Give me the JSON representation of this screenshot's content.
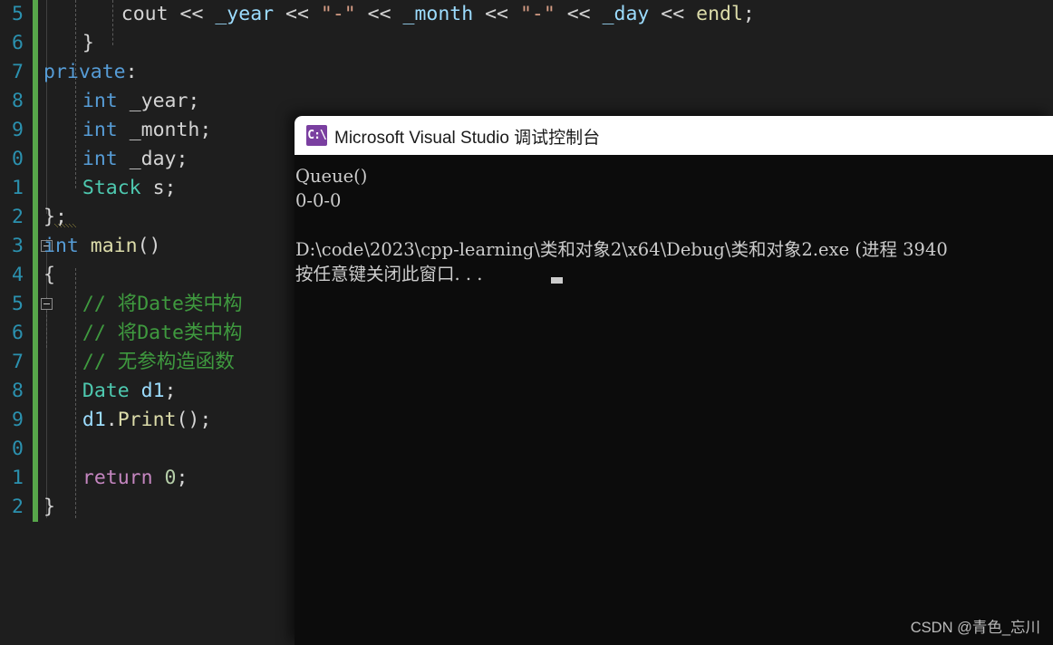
{
  "editor": {
    "name": "visual-studio-code-editor",
    "background": "#1e1e1e",
    "gutter_color": "#2b91af",
    "change_bar_color": "#57a64a",
    "lines": [
      {
        "number": "5",
        "indent": 6,
        "tokens": [
          {
            "t": "cout",
            "c": "plain"
          },
          {
            "t": " << ",
            "c": "plain"
          },
          {
            "t": "_year",
            "c": "var"
          },
          {
            "t": " << ",
            "c": "plain"
          },
          {
            "t": "\"-\"",
            "c": "str"
          },
          {
            "t": " << ",
            "c": "plain"
          },
          {
            "t": "_month",
            "c": "var"
          },
          {
            "t": " << ",
            "c": "plain"
          },
          {
            "t": "\"-\"",
            "c": "str"
          },
          {
            "t": " << ",
            "c": "plain"
          },
          {
            "t": "_day",
            "c": "var"
          },
          {
            "t": " << ",
            "c": "plain"
          },
          {
            "t": "endl",
            "c": "fn"
          },
          {
            "t": ";",
            "c": "punct"
          }
        ]
      },
      {
        "number": "6",
        "indent": 3,
        "tokens": [
          {
            "t": "}",
            "c": "punct"
          }
        ]
      },
      {
        "number": "7",
        "indent": 0,
        "tokens": [
          {
            "t": "private",
            "c": "kw"
          },
          {
            "t": ":",
            "c": "punct"
          }
        ]
      },
      {
        "number": "8",
        "indent": 3,
        "tokens": [
          {
            "t": "int",
            "c": "kw"
          },
          {
            "t": " ",
            "c": "plain"
          },
          {
            "t": "_year",
            "c": "plain"
          },
          {
            "t": ";",
            "c": "punct"
          }
        ]
      },
      {
        "number": "9",
        "indent": 3,
        "tokens": [
          {
            "t": "int",
            "c": "kw"
          },
          {
            "t": " ",
            "c": "plain"
          },
          {
            "t": "_month",
            "c": "plain"
          },
          {
            "t": ";",
            "c": "punct"
          }
        ]
      },
      {
        "number": "0",
        "indent": 3,
        "tokens": [
          {
            "t": "int",
            "c": "kw"
          },
          {
            "t": " ",
            "c": "plain"
          },
          {
            "t": "_day",
            "c": "plain"
          },
          {
            "t": ";",
            "c": "punct"
          }
        ]
      },
      {
        "number": "1",
        "indent": 3,
        "tokens": [
          {
            "t": "Stack",
            "c": "type"
          },
          {
            "t": " ",
            "c": "plain"
          },
          {
            "t": "s",
            "c": "plain"
          },
          {
            "t": ";",
            "c": "punct"
          }
        ]
      },
      {
        "number": "2",
        "indent": 0,
        "tokens": [
          {
            "t": "};",
            "c": "punct"
          }
        ]
      },
      {
        "number": "3",
        "indent": 0,
        "tokens": [
          {
            "t": "int",
            "c": "kw"
          },
          {
            "t": " ",
            "c": "plain"
          },
          {
            "t": "main",
            "c": "fn"
          },
          {
            "t": "()",
            "c": "punct"
          }
        ]
      },
      {
        "number": "4",
        "indent": 0,
        "tokens": [
          {
            "t": "{",
            "c": "punct"
          }
        ]
      },
      {
        "number": "5",
        "indent": 3,
        "tokens": [
          {
            "t": "// 将Date类中构",
            "c": "cmt"
          }
        ]
      },
      {
        "number": "6",
        "indent": 3,
        "tokens": [
          {
            "t": "// 将Date类中构",
            "c": "cmt"
          }
        ]
      },
      {
        "number": "7",
        "indent": 3,
        "tokens": [
          {
            "t": "// 无参构造函数",
            "c": "cmt"
          }
        ]
      },
      {
        "number": "8",
        "indent": 3,
        "tokens": [
          {
            "t": "Date",
            "c": "type"
          },
          {
            "t": " ",
            "c": "plain"
          },
          {
            "t": "d1",
            "c": "var"
          },
          {
            "t": ";",
            "c": "punct"
          }
        ]
      },
      {
        "number": "9",
        "indent": 3,
        "tokens": [
          {
            "t": "d1",
            "c": "var"
          },
          {
            "t": ".",
            "c": "punct"
          },
          {
            "t": "Print",
            "c": "fn"
          },
          {
            "t": "();",
            "c": "punct"
          }
        ]
      },
      {
        "number": "0",
        "indent": 3,
        "tokens": []
      },
      {
        "number": "1",
        "indent": 3,
        "tokens": [
          {
            "t": "return",
            "c": "ret"
          },
          {
            "t": " ",
            "c": "plain"
          },
          {
            "t": "0",
            "c": "num"
          },
          {
            "t": ";",
            "c": "punct"
          }
        ]
      },
      {
        "number": "2",
        "indent": 0,
        "tokens": [
          {
            "t": "}",
            "c": "punct"
          }
        ]
      }
    ]
  },
  "console": {
    "name": "visual-studio-debug-console",
    "title": "Microsoft Visual Studio 调试控制台",
    "icon_label": "C:\\",
    "icon_color": "#7a3fa0",
    "titlebar_color": "#ffffff",
    "background": "#0c0c0c",
    "output": [
      "Queue()",
      "0-0-0",
      "",
      "D:\\code\\2023\\cpp-learning\\类和对象2\\x64\\Debug\\类和对象2.exe (进程 3940",
      "按任意键关闭此窗口. . ."
    ]
  },
  "watermark": {
    "text": "CSDN @青色_忘川"
  }
}
